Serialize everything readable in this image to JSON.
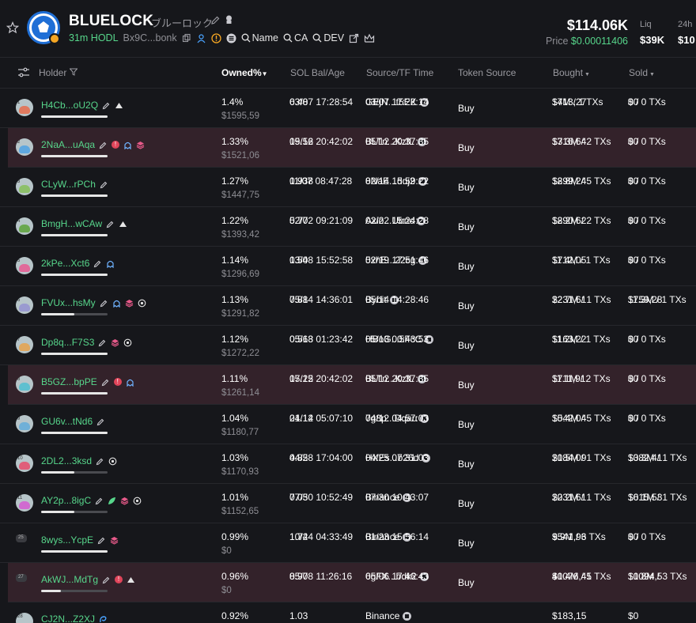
{
  "token": {
    "name": "BLUELOCK",
    "jp_name": "ブルーロック",
    "age_hodl": "31m HODL",
    "ca_short": "Bx9C...bonk",
    "links": {
      "name": "Name",
      "ca": "CA",
      "dev": "DEV"
    }
  },
  "stats": {
    "market_cap": "$114.06K",
    "price_label": "Price",
    "price_value": "$0.00011406",
    "liq_label": "Liq",
    "liq_value": "$39K",
    "h24_label": "24h",
    "h24_value": "$10"
  },
  "columns": {
    "holder": "Holder",
    "owned": "Owned%",
    "sol_bal": "SOL Bal/Age",
    "source_tf": "Source/TF Time",
    "token_source": "Token Source",
    "bought": "Bought",
    "sold": "Sold"
  },
  "rows": [
    {
      "rank": "1",
      "addr": "H4Cb...oU2Q",
      "owned": "1.4%",
      "owned_usd": "$1595,59",
      "bal": "6.48",
      "bal_time": "03/07 17:28:54",
      "src": "GEjN...t5EK",
      "src_time": "03/07 17:22:14",
      "token_src": "Buy",
      "bought": "$713,27",
      "bought_sub": "14M / 1 TXs",
      "sold": "$0",
      "sold_sub": "0 / 0 TXs",
      "remaining": 1.0,
      "hl": false,
      "tags": [
        "edit",
        "tri"
      ],
      "avatar_color": "#e07a5f"
    },
    {
      "rank": "2",
      "addr": "2NaA...uAqa",
      "owned": "1.33%",
      "owned_usd": "$1521,06",
      "bal": "19.56",
      "bal_time": "05/12 20:42:02",
      "src": "BLTn...KzfL",
      "src_time": "05/12 20:37:35",
      "token_src": "Buy",
      "bought": "$716,64",
      "bought_sub": "13.3M / 2 TXs",
      "sold": "$0",
      "sold_sub": "0 / 0 TXs",
      "remaining": 1.0,
      "hl": true,
      "tags": [
        "edit",
        "warn",
        "ghost",
        "stack"
      ],
      "avatar_color": "#5fa8e0"
    },
    {
      "rank": "3",
      "addr": "CLyW...rPCh",
      "owned": "1.27%",
      "owned_usd": "$1447,75",
      "bal": "0.938",
      "bal_time": "11/07 08:47:28",
      "src": "8NaE...doj2",
      "src_time": "02/14 15:59:22",
      "token_src": "Buy",
      "bought": "$899,24",
      "bought_sub": "12.8M / 5 TXs",
      "sold": "$0",
      "sold_sub": "0 / 0 TXs",
      "remaining": 1.0,
      "hl": false,
      "tags": [
        "edit"
      ],
      "avatar_color": "#8dc06a"
    },
    {
      "rank": "4",
      "addr": "BmgH...wCAw",
      "owned": "1.22%",
      "owned_usd": "$1393,42",
      "bal": "5.77",
      "bal_time": "02/02 09:21:09",
      "src": "Axio...Ubnc",
      "src_time": "02/22 15:24:28",
      "token_src": "Buy",
      "bought": "$890,62",
      "bought_sub": "12.2M / 2 TXs",
      "sold": "$0",
      "sold_sub": "0 / 0 TXs",
      "remaining": 1.0,
      "hl": false,
      "tags": [
        "edit",
        "tri"
      ],
      "avatar_color": "#6aa84f"
    },
    {
      "rank": "5",
      "addr": "2kPe...Xct6",
      "owned": "1.14%",
      "owned_usd": "$1296,69",
      "bal": "1.54",
      "bal_time": "03/08 15:52:58",
      "src": "5xhE...22cg",
      "src_time": "02/19 17:51:46",
      "token_src": "Buy",
      "bought": "$712,05",
      "bought_sub": "11.4M / 1 TXs",
      "sold": "$0",
      "sold_sub": "0 / 0 TXs",
      "remaining": 1.0,
      "hl": false,
      "tags": [
        "edit",
        "ghost"
      ],
      "avatar_color": "#e06a9a"
    },
    {
      "rank": "6",
      "addr": "FVUx...hsMy",
      "owned": "1.13%",
      "owned_usd": "$1291,82",
      "bal": "7.88",
      "bal_time": "05/14 14:36:01",
      "src": "Bybit",
      "src_time": "05/14 14:28:46",
      "token_src": "Buy",
      "bought": "$231,61",
      "bought_sub": "22.7M / 1 TXs",
      "sold": "$759,28",
      "sold_sub": "11.3M / 1 TXs",
      "remaining": 0.5,
      "hl": false,
      "tags": [
        "edit",
        "ghost",
        "stack",
        "target"
      ],
      "avatar_color": "#9a9ad0"
    },
    {
      "rank": "7",
      "addr": "Dp8q...F7S3",
      "owned": "1.12%",
      "owned_usd": "$1272,22",
      "bal": "0.568",
      "bal_time": "05/13 01:23:42",
      "src": "HBoG...5FcC",
      "src_time": "05/13 00:43:53",
      "token_src": "Buy",
      "bought": "$163,22",
      "bought_sub": "11.2M / 1 TXs",
      "sold": "$0",
      "sold_sub": "0 / 0 TXs",
      "remaining": 1.0,
      "hl": false,
      "tags": [
        "edit",
        "stack",
        "target"
      ],
      "avatar_color": "#e0a85f"
    },
    {
      "rank": "8",
      "addr": "B5GZ...bpPE",
      "owned": "1.11%",
      "owned_usd": "$1261,14",
      "bal": "17.25",
      "bal_time": "05/12 20:42:02",
      "src": "BLTn...KzfL",
      "src_time": "05/12 20:37:35",
      "token_src": "Buy",
      "bought": "$711,91",
      "bought_sub": "11.1M / 2 TXs",
      "sold": "$0",
      "sold_sub": "0 / 0 TXs",
      "remaining": 1.0,
      "hl": true,
      "tags": [
        "edit",
        "warn",
        "ghost"
      ],
      "avatar_color": "#5fc0d0"
    },
    {
      "rank": "9",
      "addr": "GU6v...tNd6",
      "owned": "1.04%",
      "owned_usd": "$1180,77",
      "bal": "21.14",
      "bal_time": "04/12 05:07:10",
      "src": "7g8p...Dqau",
      "src_time": "04/12 04:57:03",
      "token_src": "Buy",
      "bought": "$542,04",
      "bought_sub": "10.4M / 5 TXs",
      "sold": "$0",
      "sold_sub": "0 / 0 TXs",
      "remaining": 1.0,
      "hl": false,
      "tags": [
        "edit"
      ],
      "avatar_color": "#70b0d8"
    },
    {
      "rank": "10",
      "addr": "2DL2...3ksd",
      "owned": "1.03%",
      "owned_usd": "$1170,93",
      "bal": "4.85",
      "bal_time": "04/28 17:04:00",
      "src": "HXEs...b26d",
      "src_time": "04/25 07:31:03",
      "token_src": "Buy",
      "bought": "$184,09",
      "bought_sub": "20.5M / 1 TXs",
      "sold": "$382,41",
      "sold_sub": "10.3M / 1 TXs",
      "remaining": 0.5,
      "hl": false,
      "tags": [
        "edit",
        "target"
      ],
      "avatar_color": "#e05f7a"
    },
    {
      "rank": "11",
      "addr": "AY2p...8igC",
      "owned": "1.01%",
      "owned_usd": "$1152,65",
      "bal": "7.05",
      "bal_time": "07/30 10:52:49",
      "src": "Binance",
      "src_time": "07/30 10:43:07",
      "token_src": "Buy",
      "bought": "$231,61",
      "bought_sub": "20.2M / 1 TXs",
      "sold": "$615,53",
      "sold_sub": "10.1M / 1 TXs",
      "remaining": 0.5,
      "hl": false,
      "tags": [
        "edit",
        "leaf",
        "stack",
        "target"
      ],
      "avatar_color": "#d06ad0"
    },
    {
      "rank": "25",
      "addr": "8wys...YcpE",
      "owned": "0.99%",
      "owned_usd": "$0",
      "bal": "1.74",
      "bal_time": "10/24 04:33:49",
      "src": "Binance",
      "src_time": "01/23 15:56:14",
      "token_src": "Buy",
      "bought": "$541,96",
      "bought_sub": "9.9M / 3 TXs",
      "sold": "$0",
      "sold_sub": "0 / 0 TXs",
      "remaining": 1.0,
      "hl": false,
      "tags": [
        "edit",
        "stack"
      ],
      "avatar_color": "small"
    },
    {
      "rank": "27",
      "addr": "AkWJ...MdTg",
      "owned": "0.96%",
      "owned_usd": "$0",
      "bal": "8.97",
      "bal_time": "05/08 11:26:16",
      "src": "6gFX...bdk2",
      "src_time": "05/06 17:46:43",
      "token_src": "Buy",
      "bought": "$1076,45",
      "bought_sub": "40.4M / 1 TXs",
      "sold": "$1094,5",
      "sold_sub": "10.8M / 3 TXs",
      "remaining": 0.3,
      "hl": true,
      "tags": [
        "edit",
        "warn",
        "tri"
      ],
      "avatar_color": "small"
    },
    {
      "rank": "28",
      "addr": "CJ2N...Z2XJ",
      "owned": "0.92%",
      "owned_usd": "",
      "bal": "1.03",
      "bal_time": "",
      "src": "Binance",
      "src_time": "",
      "token_src": "",
      "bought": "$183,15",
      "bought_sub": "",
      "sold": "$0",
      "sold_sub": "",
      "remaining": 1.0,
      "hl": false,
      "tags": [
        "swirl"
      ],
      "avatar_color": "#b7c5c9"
    }
  ]
}
